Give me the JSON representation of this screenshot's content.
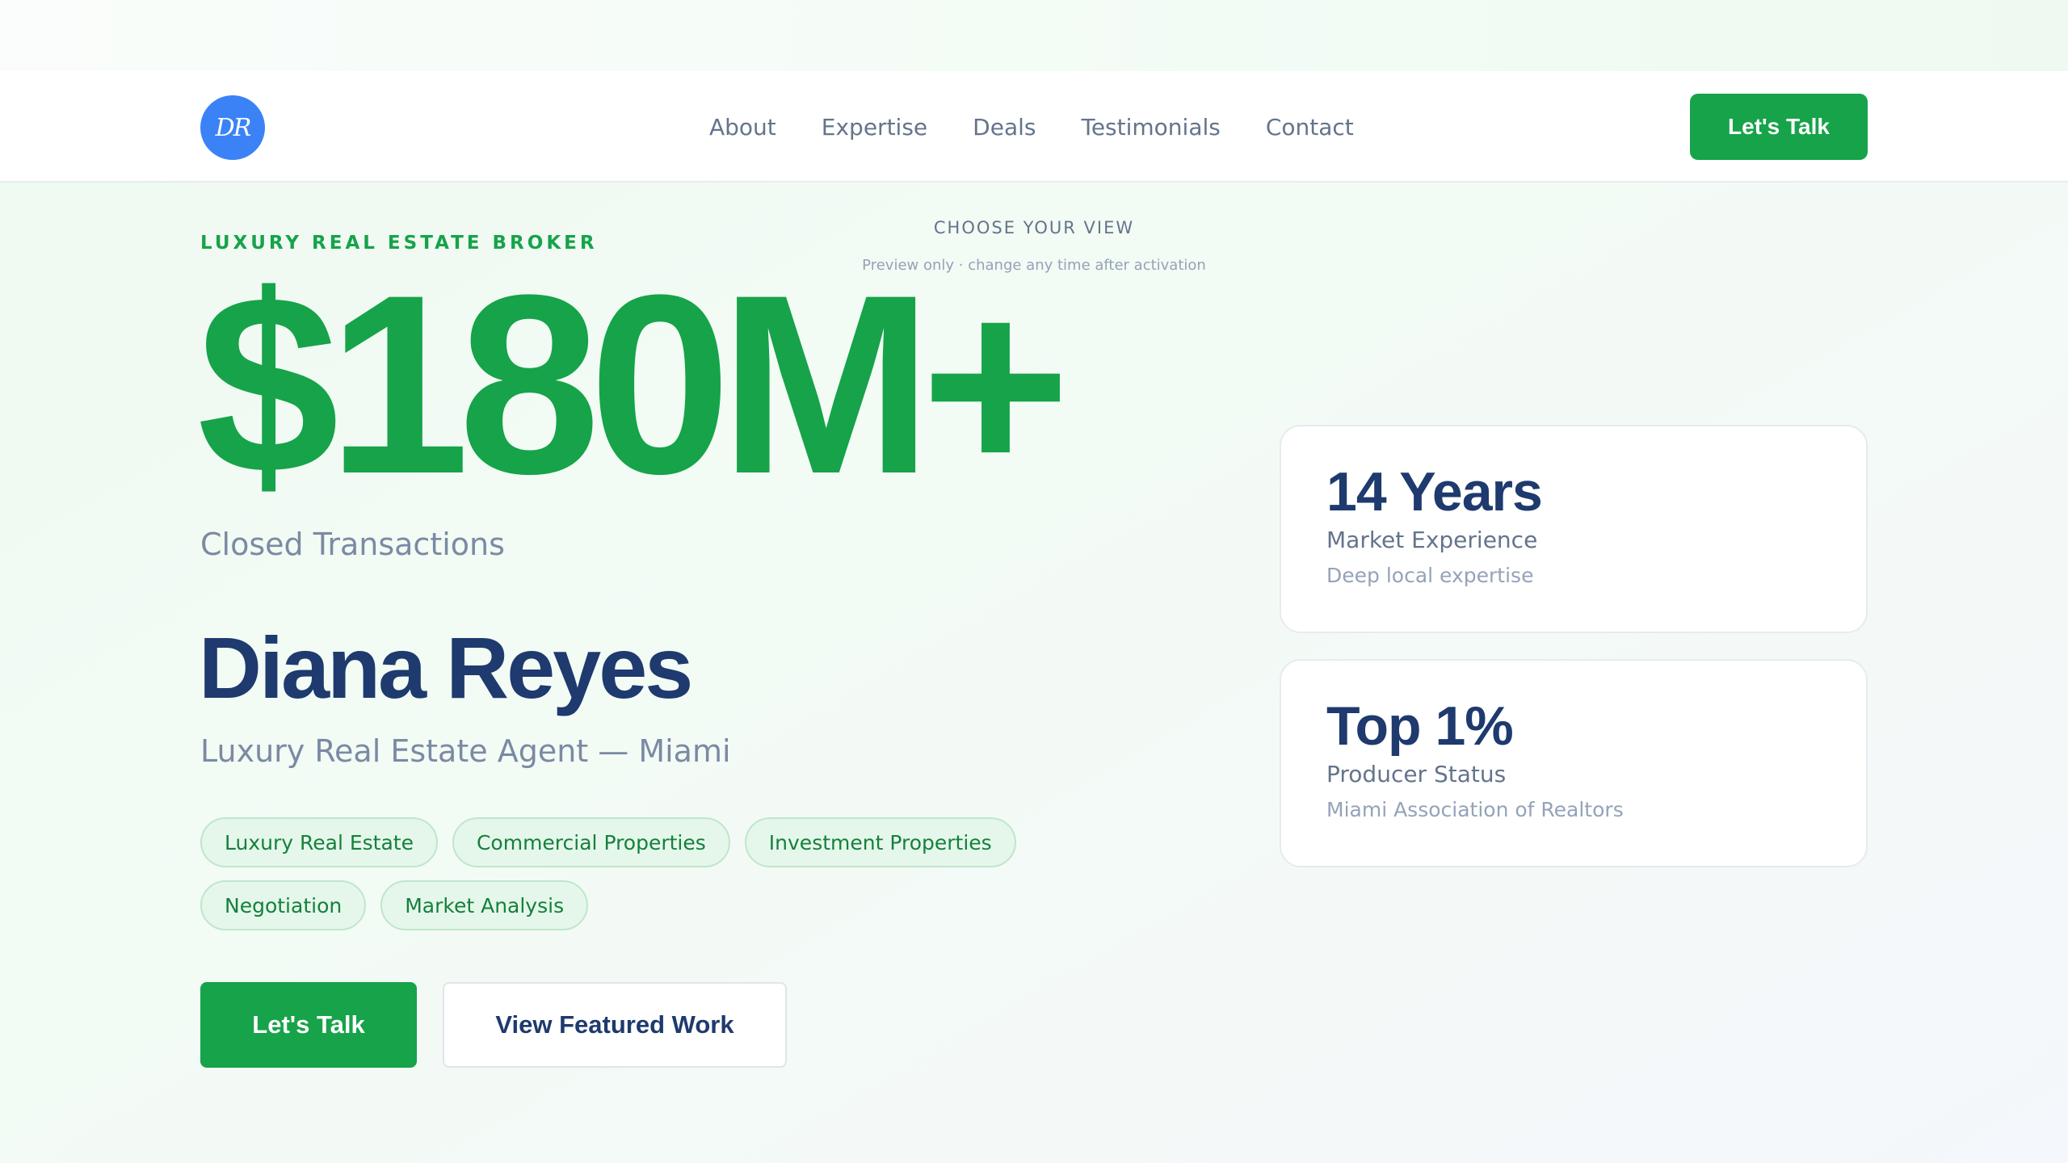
{
  "nav": {
    "logo_text": "DR",
    "links": [
      "About",
      "Expertise",
      "Deals",
      "Testimonials",
      "Contact"
    ],
    "cta_label": "Let's Talk"
  },
  "view_picker": {
    "title": "CHOOSE YOUR VIEW",
    "subtitle": "Preview only · change any time after activation"
  },
  "hero": {
    "eyebrow": "LUXURY REAL ESTATE BROKER",
    "stat_value": "$180M+",
    "stat_caption": "Closed Transactions",
    "name": "Diana Reyes",
    "role": "Luxury Real Estate Agent — Miami",
    "tags": [
      "Luxury Real Estate",
      "Commercial Properties",
      "Investment Properties",
      "Negotiation",
      "Market Analysis"
    ],
    "primary_cta": "Let's Talk",
    "secondary_cta": "View Featured Work"
  },
  "cards": [
    {
      "value": "14 Years",
      "label": "Market Experience",
      "sub": "Deep local expertise"
    },
    {
      "value": "Top 1%",
      "label": "Producer Status",
      "sub": "Miami Association of Realtors"
    }
  ],
  "colors": {
    "accent": "#16a34a",
    "navy": "#1e3a6e",
    "logo_bg": "#3b82f6",
    "muted": "#7b8aa3"
  }
}
